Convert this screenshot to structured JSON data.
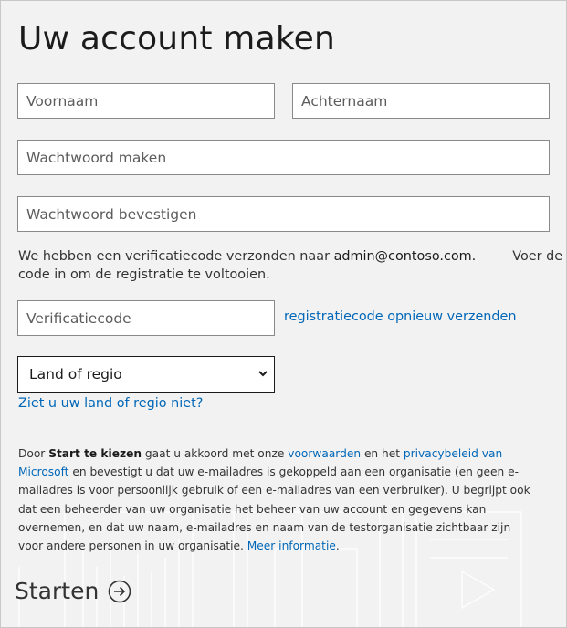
{
  "page": {
    "title": "Uw account maken"
  },
  "form": {
    "first_name_placeholder": "Voornaam",
    "last_name_placeholder": "Achternaam",
    "password_placeholder": "Wachtwoord maken",
    "confirm_password_placeholder": "Wachtwoord bevestigen",
    "verification_code_placeholder": "Verificatiecode",
    "resend_link": "registratiecode opnieuw verzenden",
    "country_select_value": "Land of regio",
    "country_help_link": "Ziet u uw land of regio niet?"
  },
  "verification": {
    "text_before": "We hebben een verificatiecode verzonden naar",
    "email": "admin@contoso.com.",
    "text_after_a": "Voer de",
    "text_after_b": "code in om de registratie te voltooien."
  },
  "legal": {
    "p1": "Door",
    "start_bold": "Start te kiezen",
    "p2": "gaat u akkoord met onze",
    "terms_link": "voorwaarden",
    "p3": "en het",
    "privacy_link": "privacybeleid van Microsoft",
    "p4": "en bevestigt u dat uw e-mailadres is gekoppeld aan een organisatie (en geen e-mailadres is voor persoonlijk gebruik of een e-mailadres van een verbruiker). U begrijpt ook dat een beheerder van uw organisatie het beheer van uw account en gegevens kan overnemen, en dat uw naam, e-mailadres en naam van de testorganisatie zichtbaar zijn voor andere personen in uw organisatie.",
    "more_link": "Meer informatie",
    "p5": "."
  },
  "actions": {
    "start_label": "Starten"
  },
  "icons": {
    "select_chevron": "chevron-down-icon",
    "start_arrow": "arrow-right-circle-icon"
  },
  "colors": {
    "background": "#f2f2f2",
    "link": "#0067b8",
    "text": "#1b1b1b"
  }
}
